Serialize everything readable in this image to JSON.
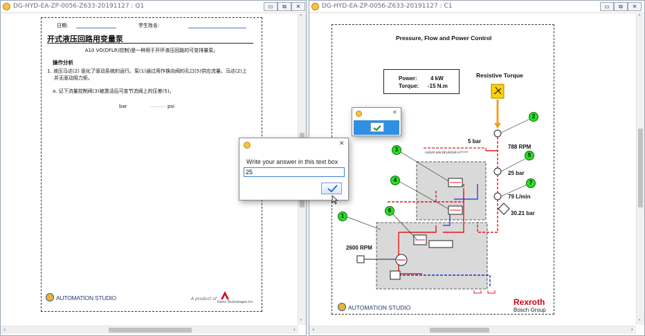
{
  "left_window": {
    "title": "DG-HYD-EA-ZP-0056-Z633-20191127 : Q1",
    "controls": {
      "minimize": "▭",
      "restore": "⧉",
      "close": "✕"
    },
    "worksheet": {
      "date_label": "日期:",
      "student_label": "学生姓名:",
      "heading": "开式液压回路用变量泵",
      "intro": "A10 VO(DFLR)控制)是一种用于开环液压回路的可变排量泵。",
      "section_title": "操作分析",
      "step1_line1": "1.  液压马达(2) 驱化了驱动系统的运行。泵(1)通过用作换向阀的孔口(5)供应流量。马达(2)上",
      "step1_line2": "并无驱动阻力矩。",
      "question_a": "a.  记下流量控制阀(3)被激活后可变节流阀上的压差(5)。",
      "unit_left": "bar",
      "dots": "............",
      "unit_right": "psi",
      "footer_logo": "AUTOMATION STUDIO",
      "footer_product": "A product of",
      "footer_company": "Famic Technologies Inc."
    }
  },
  "right_window": {
    "title": "DG-HYD-EA-ZP-0056-Z633-20191127 : C1",
    "controls": {
      "minimize": "▭",
      "restore": "⧉",
      "close": "✕"
    },
    "diagram": {
      "title": "Pressure, Flow and Power Control",
      "power_label": "Power:",
      "power_value": "4 kW",
      "torque_label": "Torque:",
      "torque_value": "-15 N.m",
      "resistive_torque": "Resistive Torque",
      "rpm_motor": "788 RPM",
      "pressure_5bar": "5 bar",
      "pressure_25bar": "25 bar",
      "flow": "79 L/min",
      "pressure_30": "30.21 bar",
      "rpm_pump": "2600 RPM",
      "pump_code": "A10VO 045 DFLR/31R-V*******",
      "badges": [
        "1",
        "2",
        "3",
        "4",
        "5",
        "6",
        "7"
      ],
      "footer_logo": "AUTOMATION STUDIO",
      "brand_name": "Rexroth",
      "brand_group": "Bosch Group"
    }
  },
  "small_dialog": {
    "close": "✕",
    "ok_icon": "check-icon"
  },
  "answer_dialog": {
    "close": "✕",
    "prompt": "Write your answer in this text box",
    "answer_value": "25",
    "ok_icon": "check-icon"
  },
  "colors": {
    "pressure_line": "#e8141b",
    "return_line": "#1b2fd6",
    "badge_green": "#24e01e",
    "rexroth_red": "#d0021b"
  }
}
